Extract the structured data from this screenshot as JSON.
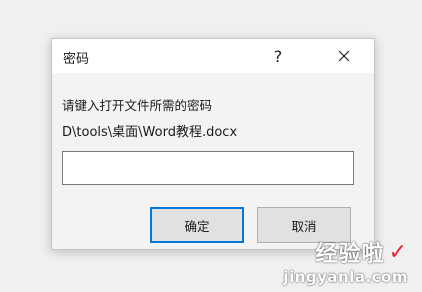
{
  "dialog": {
    "title": "密码",
    "help_label": "?",
    "prompt": "请键入打开文件所需的密码",
    "file_path": "D\\tools\\桌面\\Word教程.docx",
    "password_value": "",
    "ok_label": "确定",
    "cancel_label": "取消"
  },
  "watermark": {
    "text_cn": "经验啦",
    "check": "✓",
    "url": "jingyanla.com"
  },
  "colors": {
    "focus_border": "#0078d7",
    "check_mark": "#e0282e"
  },
  "icons": {
    "close": "close-icon",
    "check": "check-icon"
  }
}
